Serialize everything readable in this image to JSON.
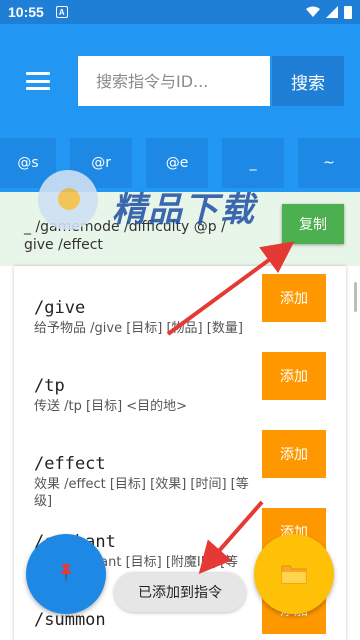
{
  "status_bar": {
    "time": "10:55",
    "notif_letter": "A"
  },
  "toolbar": {
    "search_placeholder": "搜索指令与ID...",
    "search_label": "搜索"
  },
  "quick_chips": [
    "@s",
    "@r",
    "@e",
    "_",
    "~"
  ],
  "output": {
    "text": "_ /gamemode /difficulty @p / give /effect",
    "copy_label": "复制"
  },
  "watermark": {
    "text": "精品下载"
  },
  "commands": [
    {
      "title": "/give",
      "desc": "给予物品 /give [目标] [物品] [数量]",
      "add_label": "添加"
    },
    {
      "title": "/tp",
      "desc": "传送 /tp [目标] <目的地>",
      "add_label": "添加"
    },
    {
      "title": "/effect",
      "desc": "效果 /effect [目标] [效果] [时间] [等级]",
      "add_label": "添加"
    },
    {
      "title": "/enchant",
      "desc": "附魔 /enchant [目标] [附魔ID] [等级]",
      "add_label": "添加"
    },
    {
      "title": "/summon",
      "desc": "",
      "add_label": "添加"
    }
  ],
  "toast": {
    "message": "已添加到指令"
  },
  "fabs": {
    "pin_icon": "pushpin-icon",
    "folder_icon": "folder-icon"
  },
  "colors": {
    "primary": "#2196f3",
    "primary_dark": "#1f7fd6",
    "copy": "#4caf50",
    "add": "#ff9800",
    "annotation": "#e53935"
  }
}
